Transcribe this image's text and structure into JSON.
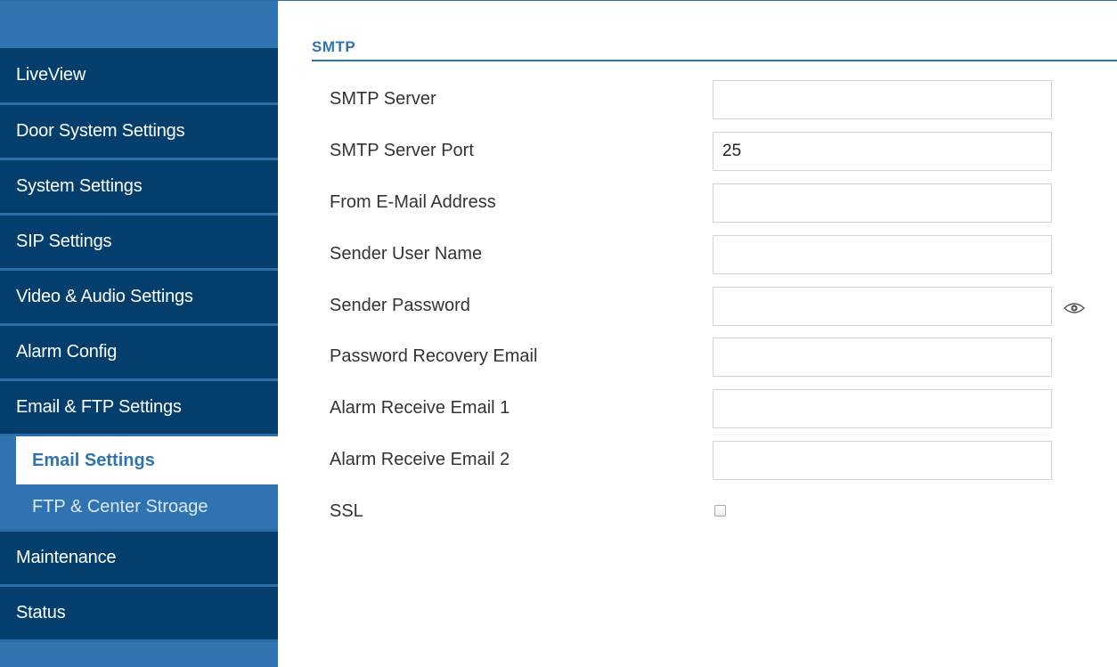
{
  "sidebar": {
    "items": [
      {
        "label": "LiveView"
      },
      {
        "label": "Door System Settings"
      },
      {
        "label": "System Settings"
      },
      {
        "label": "SIP Settings"
      },
      {
        "label": "Video & Audio Settings"
      },
      {
        "label": "Alarm Config"
      },
      {
        "label": "Email & FTP Settings"
      }
    ],
    "subitems": [
      {
        "label": "Email Settings",
        "active": true
      },
      {
        "label": "FTP & Center Stroage",
        "active": false
      }
    ],
    "bottom_items": [
      {
        "label": "Maintenance"
      },
      {
        "label": "Status"
      }
    ]
  },
  "section": {
    "title": "SMTP"
  },
  "form": {
    "smtp_server": {
      "label": "SMTP Server",
      "value": ""
    },
    "smtp_port": {
      "label": "SMTP Server Port",
      "value": "25"
    },
    "from_email": {
      "label": "From E-Mail Address",
      "value": ""
    },
    "sender_user": {
      "label": "Sender User Name",
      "value": ""
    },
    "sender_password": {
      "label": "Sender Password",
      "value": "",
      "icon": "eye-icon"
    },
    "recovery_email": {
      "label": "Password Recovery Email",
      "value": ""
    },
    "alarm_email_1": {
      "label": "Alarm Receive Email 1",
      "value": ""
    },
    "alarm_email_2": {
      "label": "Alarm Receive Email 2",
      "value": ""
    },
    "ssl": {
      "label": "SSL",
      "checked": false
    }
  },
  "colors": {
    "nav_dark": "#043e6d",
    "accent": "#2f74b1"
  }
}
